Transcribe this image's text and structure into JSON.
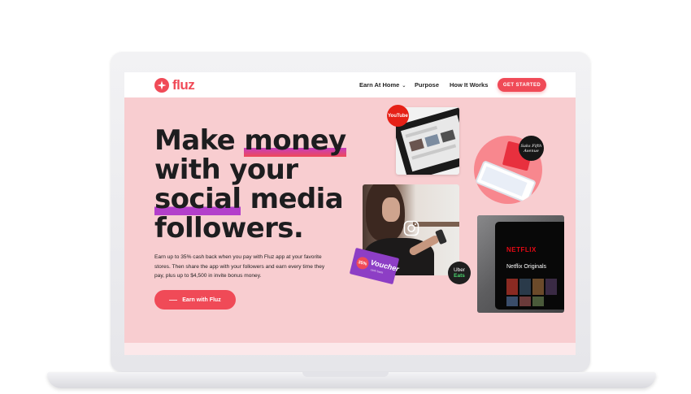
{
  "brand": {
    "name": "fluz",
    "accent": "#f04a57",
    "highlight": "#b33fcb"
  },
  "nav": {
    "items": [
      {
        "label": "Earn At Home",
        "has_dropdown": true
      },
      {
        "label": "Purpose"
      },
      {
        "label": "How It Works"
      }
    ],
    "cta_label": "GET STARTED"
  },
  "hero": {
    "headline": {
      "line1_text": "Make ",
      "line1_highlight": "money",
      "line2_text": "with your",
      "line3_highlight": "social",
      "line3_text": " media",
      "line4_text": "followers."
    },
    "body": "Earn up to 35% cash back when you pay with Fluz app at your favorite stores. Then share the app with your followers and earn every time they pay, plus up to $4,500 in invite bonus money.",
    "cta_label": "Earn with Fluz"
  },
  "collage": {
    "youtube_badge": "YouTube",
    "saks_badge": "Saks Fifth Avenue",
    "voucher": {
      "percent": "35%",
      "title": "Voucher",
      "subtitle": "cash back"
    },
    "uber_badge": {
      "line1": "Uber",
      "line2": "Eats"
    },
    "netflix": {
      "logo": "NETFLIX",
      "title": "Netflix Originals"
    },
    "icons": [
      "instagram-icon"
    ]
  }
}
